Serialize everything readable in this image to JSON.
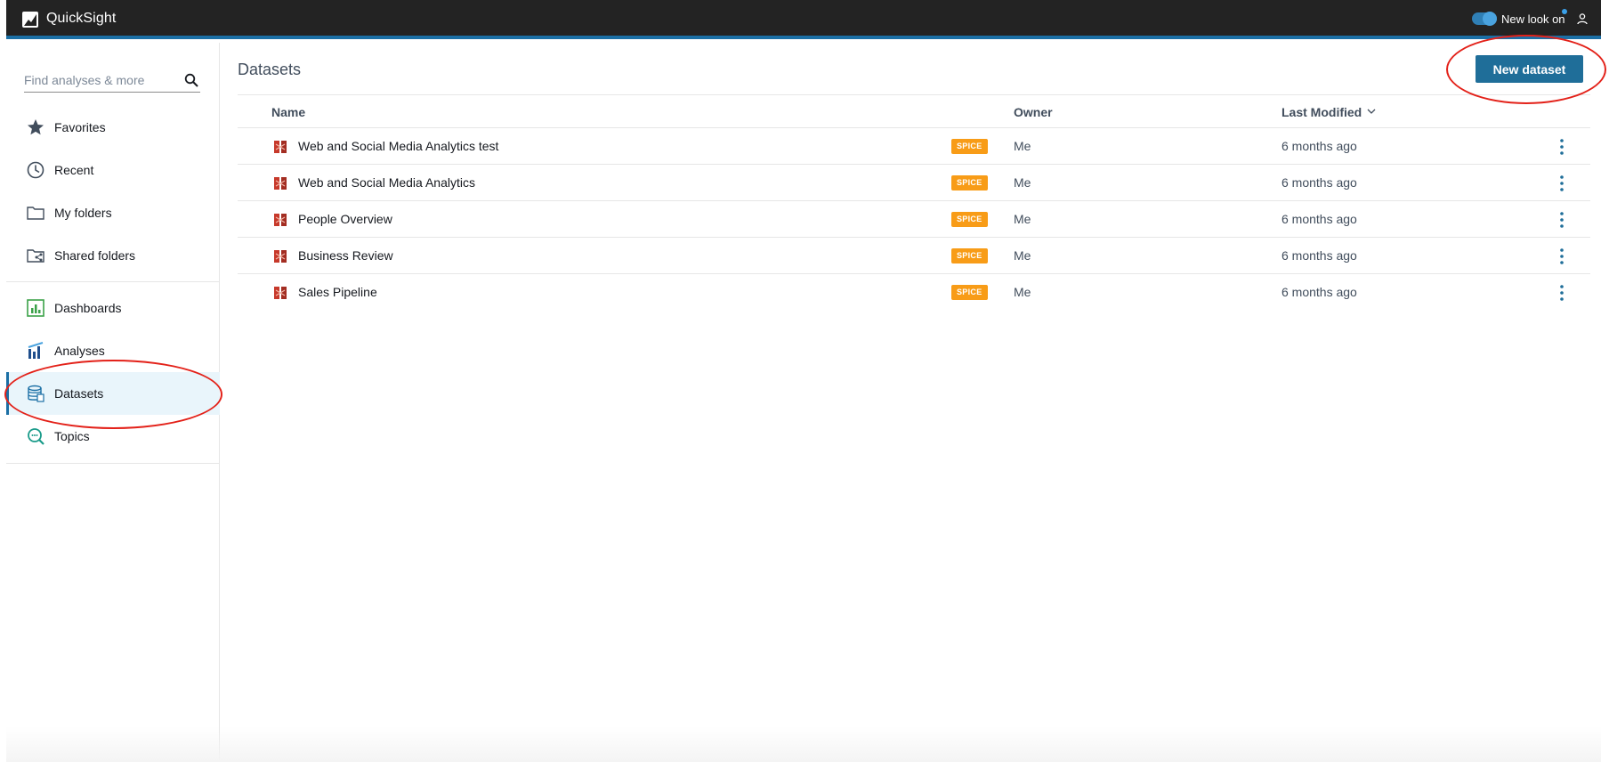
{
  "app": {
    "title": "QuickSight"
  },
  "topbar": {
    "toggle_label": "New look on"
  },
  "search": {
    "placeholder": "Find analyses & more"
  },
  "sidebar": {
    "items": [
      {
        "label": "Favorites",
        "icon": "star-icon"
      },
      {
        "label": "Recent",
        "icon": "clock-icon"
      },
      {
        "label": "My folders",
        "icon": "folder-icon"
      },
      {
        "label": "Shared folders",
        "icon": "shared-folder-icon"
      },
      {
        "label": "Dashboards",
        "icon": "dashboard-icon"
      },
      {
        "label": "Analyses",
        "icon": "analyses-icon"
      },
      {
        "label": "Datasets",
        "icon": "dataset-icon",
        "active": true
      },
      {
        "label": "Topics",
        "icon": "topics-icon"
      }
    ]
  },
  "main": {
    "title": "Datasets",
    "new_button": "New dataset",
    "columns": {
      "name": "Name",
      "owner": "Owner",
      "modified": "Last Modified"
    },
    "rows": [
      {
        "name": "Web and Social Media Analytics test",
        "badge": "SPICE",
        "owner": "Me",
        "modified": "6 months ago"
      },
      {
        "name": "Web and Social Media Analytics",
        "badge": "SPICE",
        "owner": "Me",
        "modified": "6 months ago"
      },
      {
        "name": "People Overview",
        "badge": "SPICE",
        "owner": "Me",
        "modified": "6 months ago"
      },
      {
        "name": "Business Review",
        "badge": "SPICE",
        "owner": "Me",
        "modified": "6 months ago"
      },
      {
        "name": "Sales Pipeline",
        "badge": "SPICE",
        "owner": "Me",
        "modified": "6 months ago"
      }
    ]
  },
  "colors": {
    "topbar": "#232323",
    "accent": "#1b6fa5",
    "primary_button": "#1f6e99",
    "spice_badge": "#f89c17",
    "dataset_icon": "#c7392b",
    "annotation": "#e32119"
  }
}
